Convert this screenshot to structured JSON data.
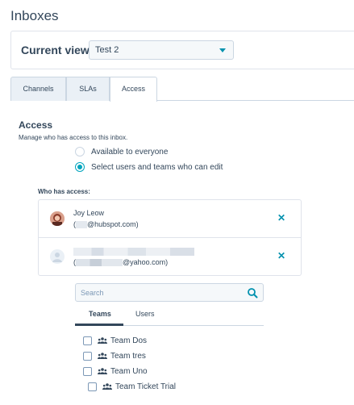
{
  "page": {
    "title": "Inboxes"
  },
  "view": {
    "label": "Current view:",
    "selected": "Test 2"
  },
  "tabs": [
    {
      "label": "Channels"
    },
    {
      "label": "SLAs"
    },
    {
      "label": "Access"
    }
  ],
  "access": {
    "title": "Access",
    "description": "Manage who has access to this inbox.",
    "options": [
      {
        "label": "Available to everyone",
        "checked": false
      },
      {
        "label": "Select users and teams who can edit",
        "checked": true
      }
    ],
    "who_label": "Who has access:",
    "users": [
      {
        "name": "Joy Leow",
        "email_prefix": "(",
        "email_suffix": "@hubspot.com)"
      },
      {
        "name": "",
        "email_prefix": "(",
        "email_suffix": "@yahoo.com)"
      }
    ]
  },
  "search": {
    "placeholder": "Search"
  },
  "sub_tabs": [
    {
      "label": "Teams"
    },
    {
      "label": "Users"
    }
  ],
  "teams": [
    {
      "label": "Team Dos"
    },
    {
      "label": "Team tres"
    },
    {
      "label": "Team Uno"
    },
    {
      "label": "Team Ticket Trial"
    }
  ],
  "colors": {
    "accent": "#00a4bd",
    "link": "#0091ae",
    "text": "#33475b",
    "border": "#cbd6e2"
  }
}
